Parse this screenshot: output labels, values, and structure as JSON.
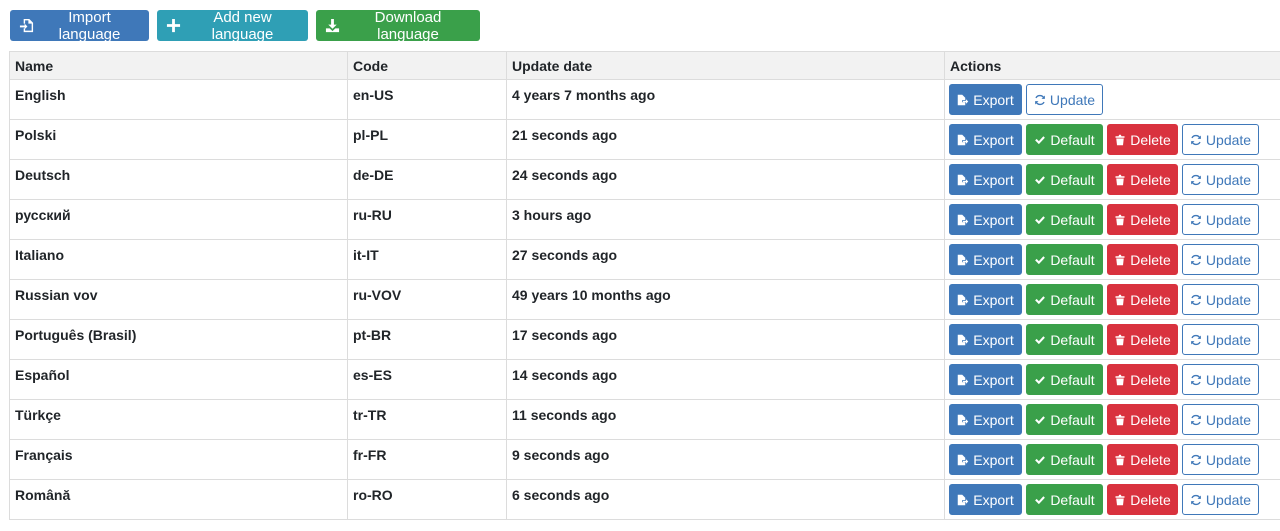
{
  "toolbar": {
    "import_label": "Import language",
    "add_label": "Add new language",
    "download_label": "Download language"
  },
  "table": {
    "headers": {
      "name": "Name",
      "code": "Code",
      "update_date": "Update date",
      "actions": "Actions"
    },
    "action_labels": {
      "export": "Export",
      "default": "Default",
      "delete": "Delete",
      "update": "Update"
    },
    "rows": [
      {
        "name": "English",
        "code": "en-US",
        "updated": "4 years 7 months ago",
        "is_default": true
      },
      {
        "name": "Polski",
        "code": "pl-PL",
        "updated": "21 seconds ago",
        "is_default": false
      },
      {
        "name": "Deutsch",
        "code": "de-DE",
        "updated": "24 seconds ago",
        "is_default": false
      },
      {
        "name": "русский",
        "code": "ru-RU",
        "updated": "3 hours ago",
        "is_default": false
      },
      {
        "name": "Italiano",
        "code": "it-IT",
        "updated": "27 seconds ago",
        "is_default": false
      },
      {
        "name": "Russian vov",
        "code": "ru-VOV",
        "updated": "49 years 10 months ago",
        "is_default": false
      },
      {
        "name": "Português (Brasil)",
        "code": "pt-BR",
        "updated": "17 seconds ago",
        "is_default": false
      },
      {
        "name": "Español",
        "code": "es-ES",
        "updated": "14 seconds ago",
        "is_default": false
      },
      {
        "name": "Türkçe",
        "code": "tr-TR",
        "updated": "11 seconds ago",
        "is_default": false
      },
      {
        "name": "Français",
        "code": "fr-FR",
        "updated": "9 seconds ago",
        "is_default": false
      },
      {
        "name": "Română",
        "code": "ro-RO",
        "updated": "6 seconds ago",
        "is_default": false
      }
    ]
  },
  "colors": {
    "primary": "#3f78b9",
    "info": "#2f9fb5",
    "success": "#3aa04a",
    "danger": "#d9323e",
    "header_bg": "#f2f2f2",
    "border": "#dcdcdc"
  },
  "icons": {
    "import": "file-import-icon",
    "add": "plus-icon",
    "download": "download-icon",
    "export": "file-export-icon",
    "default": "check-icon",
    "delete": "trash-icon",
    "update": "refresh-icon"
  }
}
